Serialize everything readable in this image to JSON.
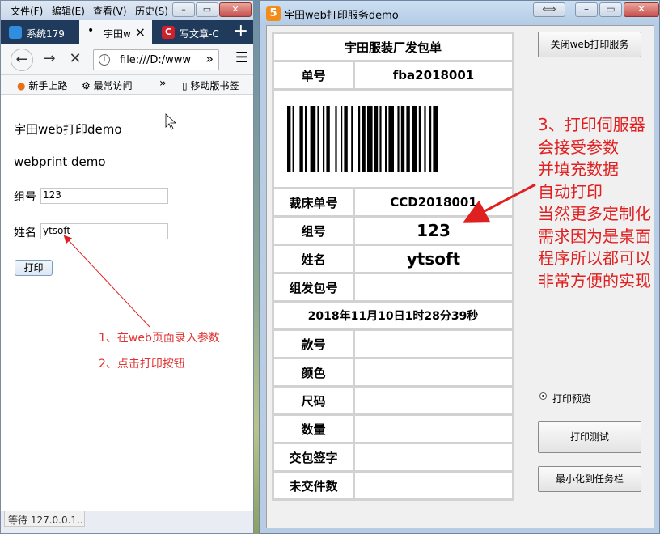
{
  "firefox": {
    "menu": [
      "文件(F)",
      "编辑(E)",
      "查看(V)",
      "历史(S)"
    ],
    "tabs": [
      {
        "label": "系统179",
        "active": false
      },
      {
        "label": "宇田w",
        "active": true
      },
      {
        "label": "写文章-C",
        "active": false
      }
    ],
    "new_tab_label": "+",
    "url": "file:///D:/www",
    "bookmarks": [
      "新手上路",
      "最常访问",
      "移动版书签"
    ],
    "bookmarks_overflow": "»",
    "page": {
      "heading": "宇田web打印demo",
      "subheading": "webprint demo",
      "group_label": "组号",
      "group_value": "123",
      "name_label": "姓名",
      "name_value": "ytsoft",
      "print_button": "打印"
    },
    "status": "等待 127.0.0.1...",
    "annotation_line1": "1、在web页面录入参数",
    "annotation_line2": "2、点击打印按钮"
  },
  "print_service": {
    "title": "宇田web打印服务demo",
    "app_icon_letter": "5",
    "bill": {
      "heading": "宇田服装厂发包单",
      "rows": [
        {
          "label": "单号",
          "value": "fba2018001"
        },
        {
          "label": "裁床单号",
          "value": "CCD2018001"
        },
        {
          "label": "组号",
          "value": "123"
        },
        {
          "label": "姓名",
          "value": "ytsoft"
        },
        {
          "label": "组发包号",
          "value": ""
        }
      ],
      "datetime": "2018年11月10日1时28分39秒",
      "rows2": [
        {
          "label": "款号",
          "value": ""
        },
        {
          "label": "颜色",
          "value": ""
        },
        {
          "label": "尺码",
          "value": ""
        },
        {
          "label": "数量",
          "value": ""
        },
        {
          "label": "交包签字",
          "value": ""
        },
        {
          "label": "未交件数",
          "value": ""
        }
      ]
    },
    "buttons": {
      "close_service": "关闭web打印服务",
      "print_test": "打印测试",
      "minimize_tray": "最小化到任务栏"
    },
    "preview_label": "打印预览",
    "annotation_lines": [
      "3、打印伺服器",
      "会接受参数",
      "并填充数据",
      "自动打印",
      "当然更多定制化",
      "需求因为是桌面",
      "程序所以都可以",
      "非常方便的实现"
    ]
  },
  "colors": {
    "annotation_red": "#e02020",
    "tab_bar": "#1f3a5a",
    "app_icon": "#f28c1a"
  },
  "icons": [
    "back-arrow-icon",
    "forward-arrow-icon",
    "stop-icon",
    "info-icon",
    "overflow-chevron-icon",
    "hamburger-menu-icon",
    "gear-icon",
    "mobile-icon",
    "barcode-graphic",
    "radio-selected"
  ]
}
